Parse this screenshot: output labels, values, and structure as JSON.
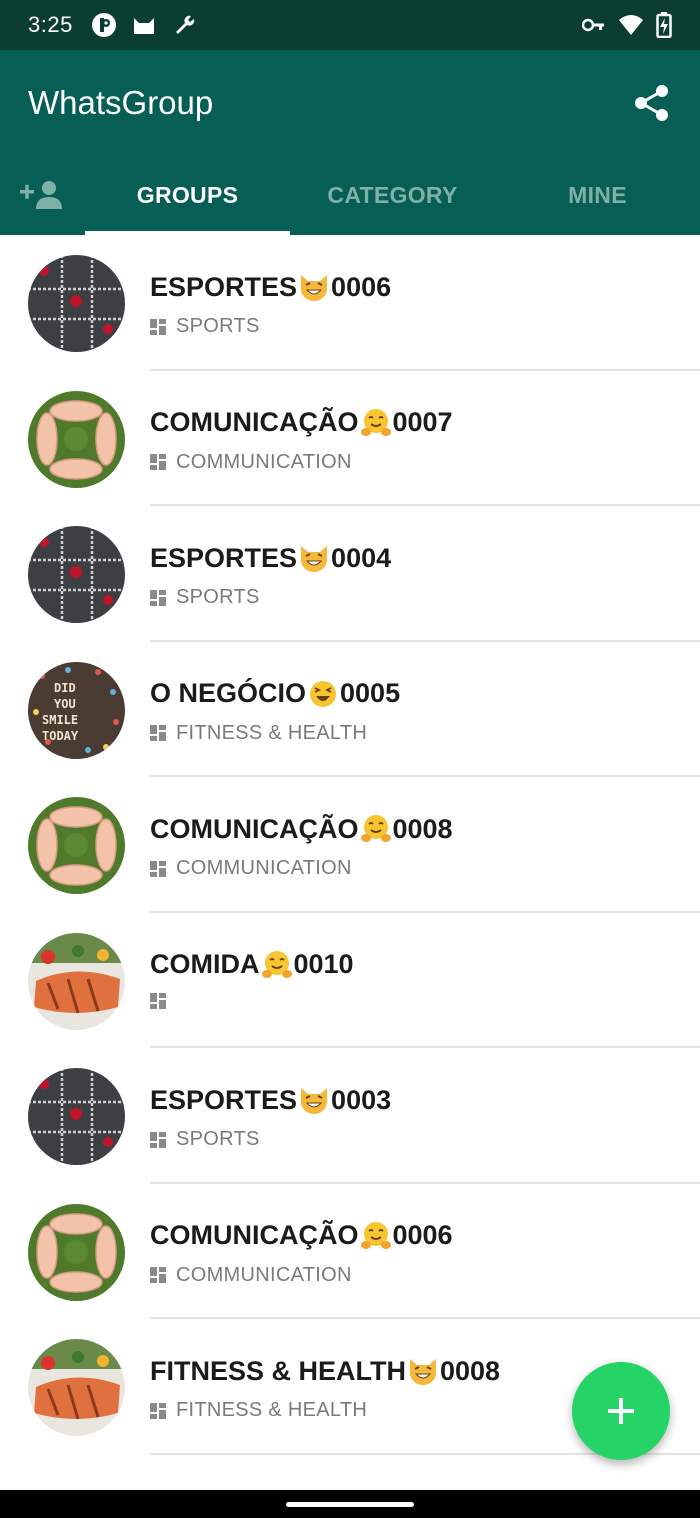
{
  "status_bar": {
    "time": "3:25",
    "left_icons": [
      "pinterest-style-icon",
      "cat-icon",
      "wrench-icon"
    ],
    "right_icons": [
      "vpn-key-icon",
      "wifi-icon",
      "battery-charging-icon"
    ]
  },
  "app_bar": {
    "title": "WhatsGroup",
    "action_icon": "share-icon"
  },
  "tabs": [
    {
      "label": "",
      "icon": "add-person-icon",
      "active": false
    },
    {
      "label": "GROUPS",
      "active": true
    },
    {
      "label": "CATEGORY",
      "active": false
    },
    {
      "label": "MINE",
      "active": false
    }
  ],
  "groups": [
    {
      "name": "ESPORTES",
      "emoji": "grinning-cat",
      "number": "0006",
      "category": "SPORTS",
      "thumbnail": "chalk-grid"
    },
    {
      "name": "COMUNICAÇÃO",
      "emoji": "hugging-face",
      "number": "0007",
      "category": "COMMUNICATION",
      "thumbnail": "hands-circle"
    },
    {
      "name": "ESPORTES",
      "emoji": "grinning-cat",
      "number": "0004",
      "category": "SPORTS",
      "thumbnail": "chalk-grid"
    },
    {
      "name": "O NEGÓCIO",
      "emoji": "laughing-face",
      "number": "0005",
      "category": "FITNESS & HEALTH",
      "thumbnail": "smile-letters"
    },
    {
      "name": "COMUNICAÇÃO",
      "emoji": "hugging-face",
      "number": "0008",
      "category": "COMMUNICATION",
      "thumbnail": "hands-circle"
    },
    {
      "name": "COMIDA",
      "emoji": "hugging-face",
      "number": "0010",
      "category": "",
      "thumbnail": "grilled-salmon"
    },
    {
      "name": "ESPORTES",
      "emoji": "grinning-cat",
      "number": "0003",
      "category": "SPORTS",
      "thumbnail": "chalk-grid"
    },
    {
      "name": "COMUNICAÇÃO",
      "emoji": "hugging-face",
      "number": "0006",
      "category": "COMMUNICATION",
      "thumbnail": "hands-circle"
    },
    {
      "name": "FITNESS & HEALTH",
      "emoji": "grinning-cat",
      "number": "0008",
      "category": "FITNESS & HEALTH",
      "thumbnail": "grilled-salmon"
    }
  ],
  "fab": {
    "icon": "plus-icon"
  },
  "colors": {
    "status_bar": "#0b3d33",
    "app_bar": "#075e54",
    "tab_inactive": "#7fb0a8",
    "fab": "#25d366"
  }
}
